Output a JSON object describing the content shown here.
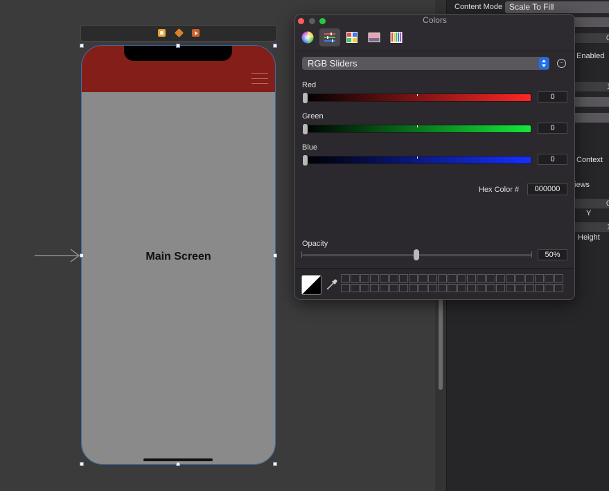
{
  "canvas": {
    "scene_title": "Main Screen",
    "colors": {
      "header": "#841e18",
      "screen": "#8a8a8a"
    }
  },
  "inspector": {
    "content_mode_label": "Content Mode",
    "content_mode_value": "Scale To Fill",
    "enabled_label": "Enabled",
    "context_label": "Context",
    "views_label": "iews",
    "y_label": "Y",
    "height_label": "Height",
    "num_1": "0",
    "num_2": "1",
    "num_3": "0",
    "num_4": "1"
  },
  "colors_panel": {
    "title": "Colors",
    "modes": [
      "color-wheel",
      "color-sliders",
      "color-palettes",
      "image-palettes",
      "pencils"
    ],
    "active_mode": "color-sliders",
    "slider_mode": "RGB Sliders",
    "sliders": [
      {
        "label": "Red",
        "value": "0",
        "color": "#ff2626"
      },
      {
        "label": "Green",
        "value": "0",
        "color": "#14e83a"
      },
      {
        "label": "Blue",
        "value": "0",
        "color": "#1630ff"
      }
    ],
    "hex_label": "Hex Color #",
    "hex_value": "000000",
    "opacity_label": "Opacity",
    "opacity_value": "50%",
    "opacity_fraction": 0.5,
    "swatch_rows": 2,
    "swatch_cols": 23
  }
}
